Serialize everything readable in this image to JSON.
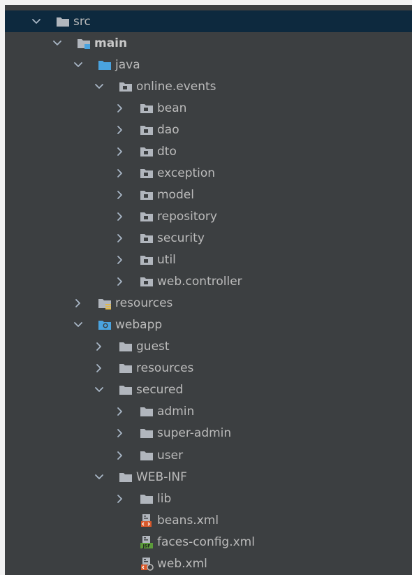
{
  "tree": [
    {
      "label": "src",
      "depth": 0,
      "expanded": true,
      "icon": "folder",
      "selected": true
    },
    {
      "label": "main",
      "depth": 1,
      "expanded": true,
      "icon": "module-folder",
      "bold": true
    },
    {
      "label": "java",
      "depth": 2,
      "expanded": true,
      "icon": "source-folder"
    },
    {
      "label": "online.events",
      "depth": 3,
      "expanded": true,
      "icon": "package"
    },
    {
      "label": "bean",
      "depth": 4,
      "expanded": false,
      "icon": "package"
    },
    {
      "label": "dao",
      "depth": 4,
      "expanded": false,
      "icon": "package"
    },
    {
      "label": "dto",
      "depth": 4,
      "expanded": false,
      "icon": "package"
    },
    {
      "label": "exception",
      "depth": 4,
      "expanded": false,
      "icon": "package"
    },
    {
      "label": "model",
      "depth": 4,
      "expanded": false,
      "icon": "package"
    },
    {
      "label": "repository",
      "depth": 4,
      "expanded": false,
      "icon": "package"
    },
    {
      "label": "security",
      "depth": 4,
      "expanded": false,
      "icon": "package"
    },
    {
      "label": "util",
      "depth": 4,
      "expanded": false,
      "icon": "package"
    },
    {
      "label": "web.controller",
      "depth": 4,
      "expanded": false,
      "icon": "package"
    },
    {
      "label": "resources",
      "depth": 2,
      "expanded": false,
      "icon": "resources-folder"
    },
    {
      "label": "webapp",
      "depth": 2,
      "expanded": true,
      "icon": "web-folder"
    },
    {
      "label": "guest",
      "depth": 3,
      "expanded": false,
      "icon": "folder"
    },
    {
      "label": "resources",
      "depth": 3,
      "expanded": false,
      "icon": "folder"
    },
    {
      "label": "secured",
      "depth": 3,
      "expanded": true,
      "icon": "folder"
    },
    {
      "label": "admin",
      "depth": 4,
      "expanded": false,
      "icon": "folder"
    },
    {
      "label": "super-admin",
      "depth": 4,
      "expanded": false,
      "icon": "folder"
    },
    {
      "label": "user",
      "depth": 4,
      "expanded": false,
      "icon": "folder"
    },
    {
      "label": "WEB-INF",
      "depth": 3,
      "expanded": true,
      "icon": "folder"
    },
    {
      "label": "lib",
      "depth": 4,
      "expanded": false,
      "icon": "folder"
    },
    {
      "label": "beans.xml",
      "depth": 4,
      "leaf": true,
      "icon": "xml-file-icon"
    },
    {
      "label": "faces-config.xml",
      "depth": 4,
      "leaf": true,
      "icon": "jsf-file-icon"
    },
    {
      "label": "web.xml",
      "depth": 4,
      "leaf": true,
      "icon": "web-xml-file-icon"
    }
  ],
  "colors": {
    "background": "#3c3f41",
    "selection": "#0d293e",
    "text": "#bbbbbb",
    "folder": "#b1b6bd",
    "source_folder": "#4aa3df",
    "web_folder": "#4aa3df",
    "xml_badge": "#d9592b",
    "jsf_badge": "#5b9b3a"
  }
}
